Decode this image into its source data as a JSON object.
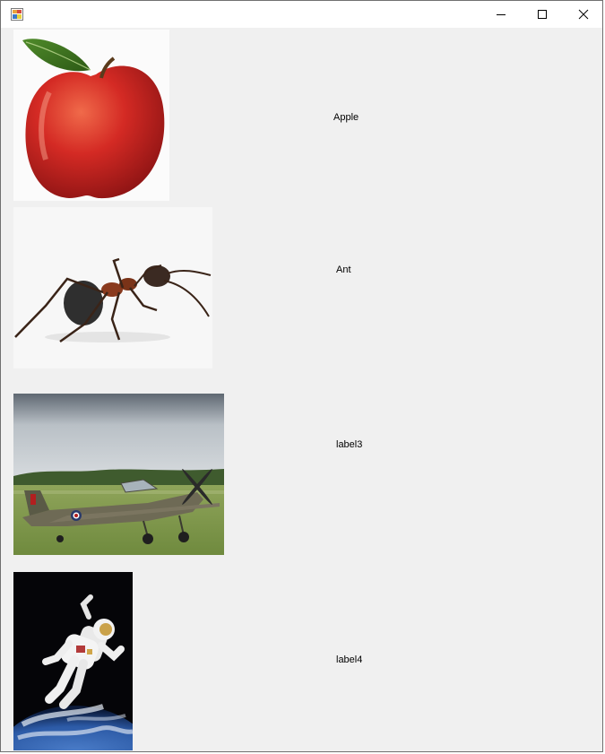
{
  "window": {
    "title": "",
    "icon": "winforms-app-icon",
    "controls": {
      "minimize_icon": "minimize-icon",
      "maximize_icon": "maximize-icon",
      "close_icon": "close-icon"
    }
  },
  "items": [
    {
      "picture": "apple-image",
      "label": "Apple"
    },
    {
      "picture": "ant-image",
      "label": "Ant"
    },
    {
      "picture": "airplane-image",
      "label": "label3"
    },
    {
      "picture": "astronaut-image",
      "label": "label4"
    }
  ]
}
